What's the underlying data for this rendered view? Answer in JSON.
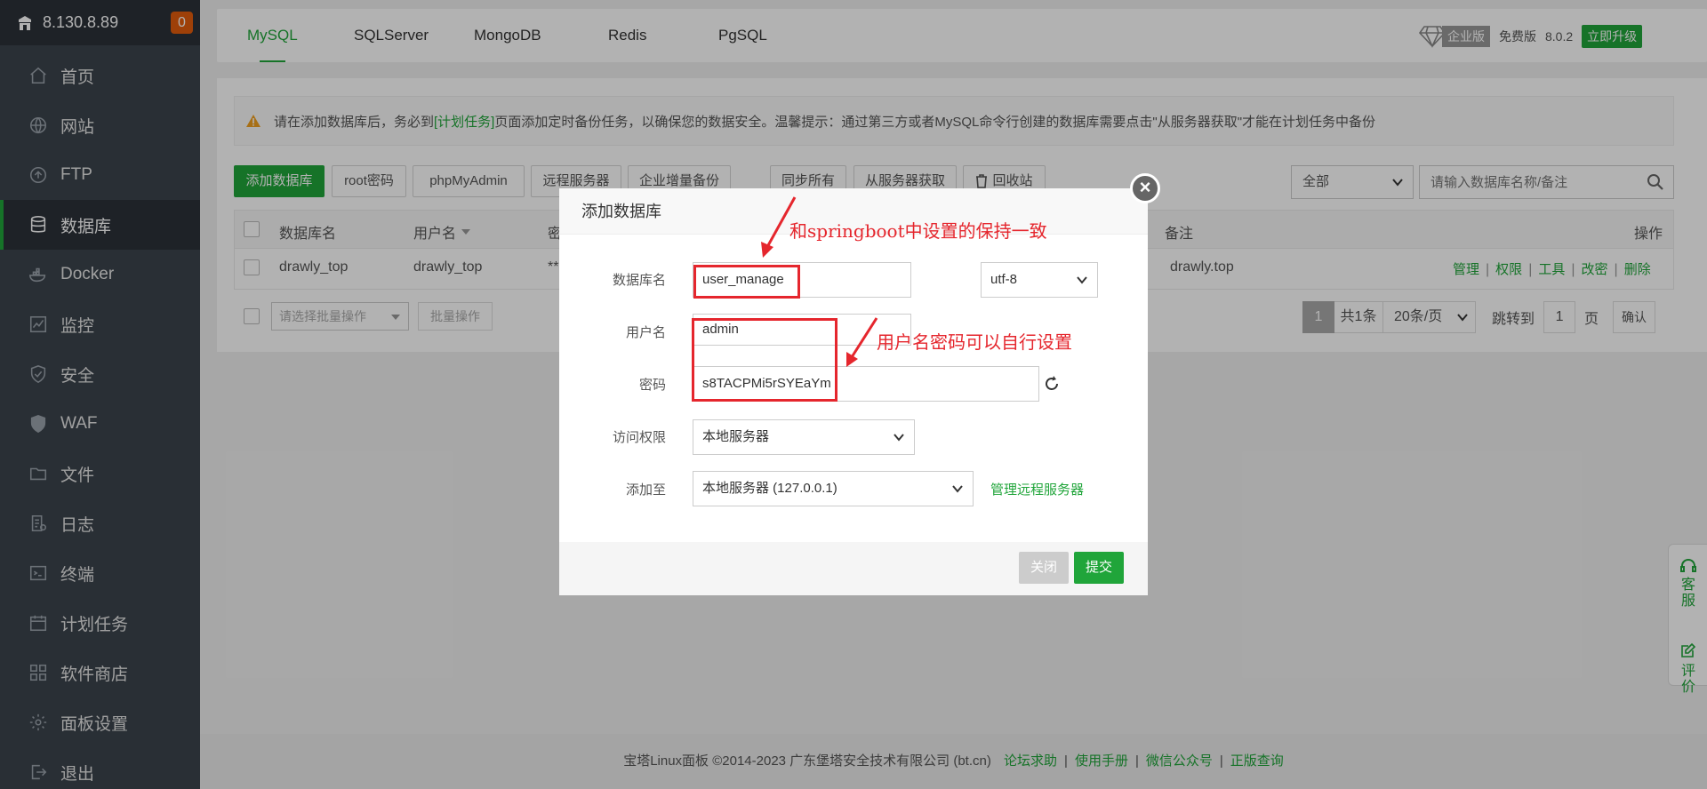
{
  "sidebar": {
    "server_ip": "8.130.8.89",
    "badge": "0",
    "items": [
      {
        "label": "首页",
        "icon": "home-icon"
      },
      {
        "label": "网站",
        "icon": "globe-icon"
      },
      {
        "label": "FTP",
        "icon": "ftp-icon"
      },
      {
        "label": "数据库",
        "icon": "database-icon",
        "active": true
      },
      {
        "label": "Docker",
        "icon": "docker-icon"
      },
      {
        "label": "监控",
        "icon": "monitor-icon"
      },
      {
        "label": "安全",
        "icon": "shield-icon"
      },
      {
        "label": "WAF",
        "icon": "waf-icon"
      },
      {
        "label": "文件",
        "icon": "folder-icon"
      },
      {
        "label": "日志",
        "icon": "log-icon"
      },
      {
        "label": "终端",
        "icon": "terminal-icon"
      },
      {
        "label": "计划任务",
        "icon": "calendar-icon"
      },
      {
        "label": "软件商店",
        "icon": "grid-icon"
      },
      {
        "label": "面板设置",
        "icon": "gear-icon"
      },
      {
        "label": "退出",
        "icon": "logout-icon"
      }
    ]
  },
  "tabs": [
    "MySQL",
    "SQLServer",
    "MongoDB",
    "Redis",
    "PgSQL"
  ],
  "edition": {
    "enterprise": "企业版",
    "free": "免费版",
    "version": "8.0.2",
    "upgrade": "立即升级"
  },
  "notice": {
    "prefix": "请在添加数据库后，务必到",
    "link": "[计划任务]",
    "suffix": "页面添加定时备份任务，以确保您的数据安全。温馨提示：通过第三方或者MySQL命令行创建的数据库需要点击\"从服务器获取\"才能在计划任务中备份"
  },
  "toolbar": {
    "add_db": "添加数据库",
    "root_pwd": "root密码",
    "phpmyadmin": "phpMyAdmin",
    "remote": "远程服务器",
    "enterprise_backup": "企业增量备份",
    "sync_all": "同步所有",
    "fetch_from_server": "从服务器获取",
    "recycle_bin": "回收站",
    "filter": "全部",
    "search_placeholder": "请输入数据库名称/备注"
  },
  "table": {
    "headers": {
      "name": "数据库名",
      "user": "用户名",
      "password": "密",
      "remark": "备注",
      "ops": "操作"
    },
    "rows": [
      {
        "name": "drawly_top",
        "user": "drawly_top",
        "password": "**",
        "remark": "drawly.top",
        "ops": [
          "管理",
          "权限",
          "工具",
          "改密",
          "删除"
        ]
      }
    ]
  },
  "batch": {
    "select_placeholder": "请选择批量操作",
    "button": "批量操作"
  },
  "pager": {
    "current": "1",
    "total": "共1条",
    "per_page": "20条/页",
    "jump_label": "跳转到",
    "jump_value": "1",
    "page_suffix": "页",
    "confirm": "确认"
  },
  "footer": {
    "copyright": "宝塔Linux面板 ©2014-2023 广东堡塔安全技术有限公司 (bt.cn)",
    "links": [
      "论坛求助",
      "使用手册",
      "微信公众号",
      "正版查询"
    ]
  },
  "modal": {
    "title": "添加数据库",
    "fields": {
      "db_name_label": "数据库名",
      "db_name_value": "user_manage",
      "charset": "utf-8",
      "user_label": "用户名",
      "user_value": "admin",
      "password_label": "密码",
      "password_value": "s8TACPMi5rSYEaYm",
      "access_label": "访问权限",
      "access_value": "本地服务器",
      "add_to_label": "添加至",
      "add_to_value": "本地服务器 (127.0.0.1)",
      "manage_remote": "管理远程服务器"
    },
    "close": "关闭",
    "submit": "提交"
  },
  "annotations": {
    "note1": "和springboot中设置的保持一致",
    "note2": "用户名密码可以自行设置"
  },
  "side_widget": {
    "service": "客服",
    "rate": "评价"
  },
  "colors": {
    "accent": "#20a53a",
    "sidebar": "#3c444d",
    "annotation": "#e5262d"
  }
}
